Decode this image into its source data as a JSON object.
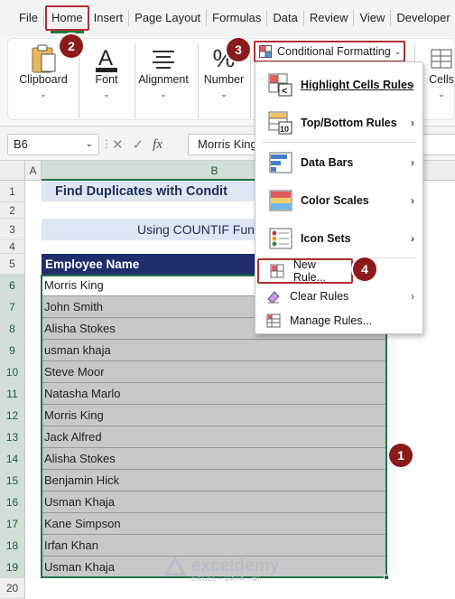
{
  "tabs": [
    "File",
    "Home",
    "Insert",
    "Page Layout",
    "Formulas",
    "Data",
    "Review",
    "View",
    "Developer"
  ],
  "ribbon": {
    "clipboard": "Clipboard",
    "font": "Font",
    "alignment": "Alignment",
    "number": "Number",
    "cells": "Cells",
    "conditional_formatting": "Conditional Formatting"
  },
  "formula_bar": {
    "name_box": "B6",
    "formula": "Morris King"
  },
  "columns": [
    "A",
    "B"
  ],
  "rows": [
    "1",
    "2",
    "3",
    "4",
    "5",
    "6",
    "7",
    "8",
    "9",
    "10",
    "11",
    "12",
    "13",
    "14",
    "15",
    "16",
    "17",
    "18",
    "19",
    "20"
  ],
  "sheet": {
    "title": "Find Duplicates with Condit",
    "subtitle": "Using COUNTIF Fun",
    "header": "Employee Name",
    "employees": [
      "Morris King",
      "John Smith",
      "Alisha Stokes",
      "usman khaja",
      "Steve Moor",
      "Natasha Marlo",
      "Morris King",
      "Jack Alfred",
      "Alisha Stokes",
      "Benjamin Hick",
      "Usman Khaja",
      "Kane Simpson",
      "Irfan Khan",
      "Usman Khaja"
    ]
  },
  "menu": {
    "highlight_cells_rules": "Highlight Cells Rules",
    "top_bottom_rules": "Top/Bottom Rules",
    "data_bars": "Data Bars",
    "color_scales": "Color Scales",
    "icon_sets": "Icon Sets",
    "new_rule": "New Rule...",
    "clear_rules": "Clear Rules",
    "manage_rules": "Manage Rules..."
  },
  "badges": [
    "1",
    "2",
    "3",
    "4"
  ],
  "watermark": {
    "brand": "exceldemy",
    "tagline": "EXCEL · DATA · BI"
  },
  "colors": {
    "accent_green": "#217346",
    "badge": "#8b1a1a",
    "highlight_border": "#b03030",
    "table_header": "#1f2d6b",
    "title_fill": "#dfe6f3",
    "selection_fill": "#c8c8c8"
  }
}
